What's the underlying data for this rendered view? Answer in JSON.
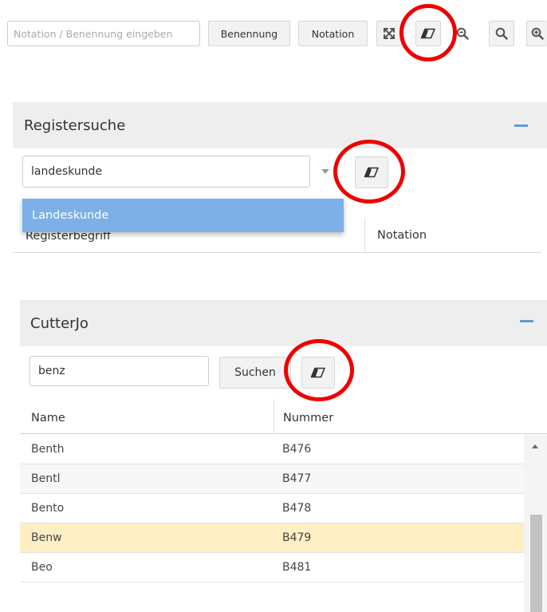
{
  "toolbar": {
    "search_placeholder": "Notation / Benennung eingeben",
    "search_value": "",
    "benennung_label": "Benennung",
    "notation_label": "Notation",
    "icons": [
      "fullscreen-icon",
      "eraser-icon",
      "zoom-out-icon",
      "search-icon",
      "zoom-in-icon"
    ]
  },
  "registersuche": {
    "title": "Registersuche",
    "input_value": "landeskunde",
    "dropdown_items": [
      "Landeskunde"
    ],
    "columns": [
      "Registerbegriff",
      "Notation"
    ]
  },
  "cutterjo": {
    "title": "CutterJo",
    "input_value": "benz",
    "search_label": "Suchen",
    "columns": [
      "Name",
      "Nummer"
    ],
    "rows": [
      {
        "name": "Benth",
        "number": "B476"
      },
      {
        "name": "Bentl",
        "number": "B477"
      },
      {
        "name": "Bento",
        "number": "B478"
      },
      {
        "name": "Benw",
        "number": "B479"
      },
      {
        "name": "Beo",
        "number": "B481"
      }
    ],
    "selected_row_index": 3
  },
  "colors": {
    "accent": "#5b9bd5",
    "dropdown_highlight": "#7cb0e6",
    "selected_row": "#fcefc4",
    "alt_row": "#f7f7f7",
    "annotation": "#ee0000"
  }
}
